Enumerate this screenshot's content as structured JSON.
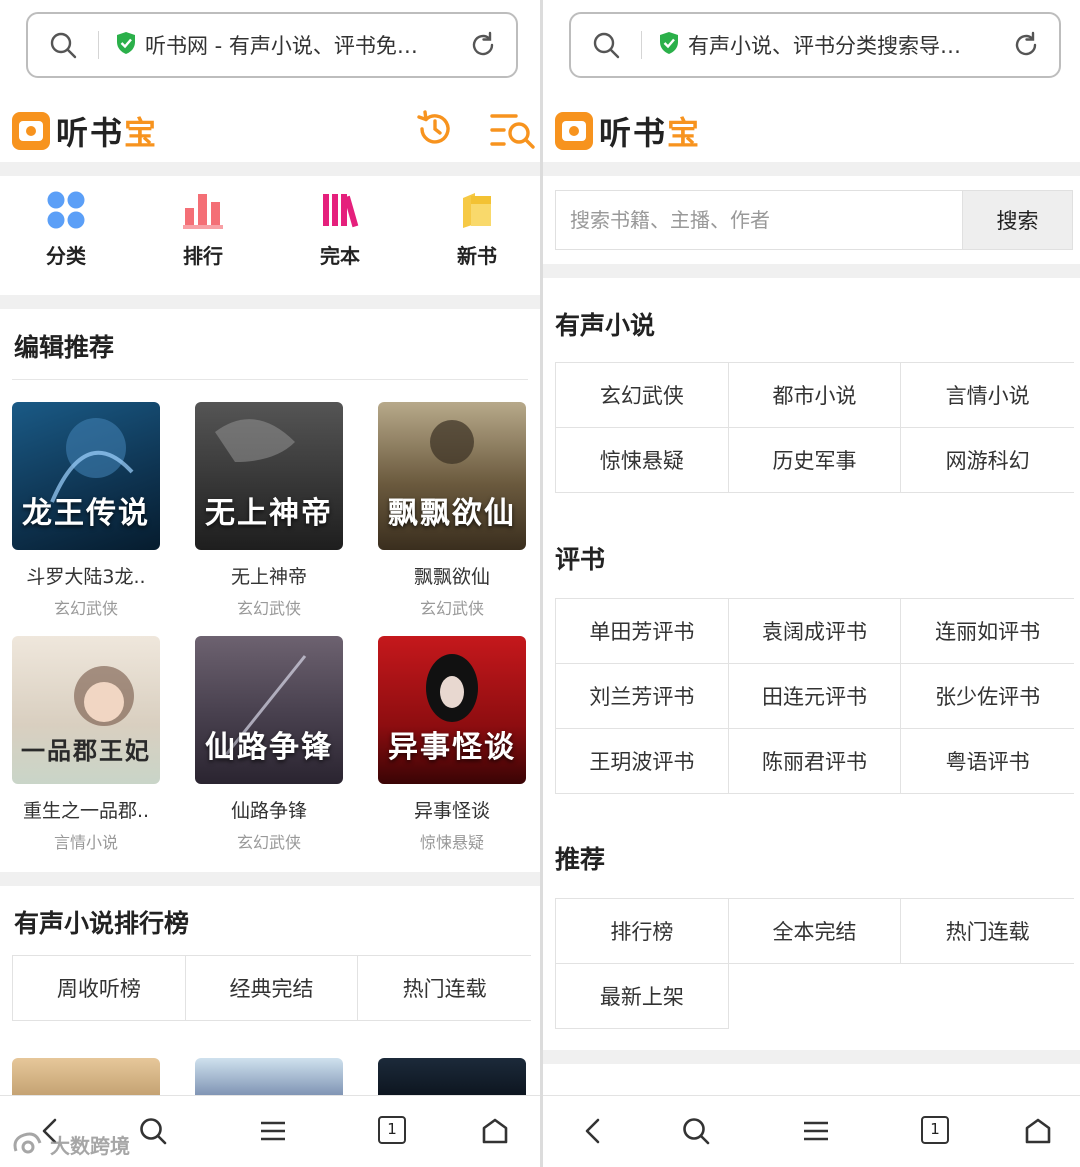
{
  "left": {
    "url_title": "听书网 - 有声小说、评书免…",
    "logo": {
      "part1": "听书",
      "part2": "宝"
    },
    "nav": [
      {
        "label": "分类",
        "icon": "grid-icon"
      },
      {
        "label": "排行",
        "icon": "bar-chart-icon"
      },
      {
        "label": "完本",
        "icon": "books-icon"
      },
      {
        "label": "新书",
        "icon": "new-book-icon"
      }
    ],
    "editor_title": "编辑推荐",
    "books": [
      {
        "title": "斗罗大陆3龙..",
        "category": "玄幻武侠",
        "cover_text": "龙王传说",
        "cover_bg": "#0e3350"
      },
      {
        "title": "无上神帝",
        "category": "玄幻武侠",
        "cover_text": "无上神帝",
        "cover_bg": "#2b2b2b"
      },
      {
        "title": "飘飘欲仙",
        "category": "玄幻武侠",
        "cover_text": "飘飘欲仙",
        "cover_bg": "#6b5a3e"
      },
      {
        "title": "重生之一品郡..",
        "category": "言情小说",
        "cover_text": "一品郡王妃",
        "cover_bg": "#d9cfc0"
      },
      {
        "title": "仙路争锋",
        "category": "玄幻武侠",
        "cover_text": "仙路争锋",
        "cover_bg": "#4a4250"
      },
      {
        "title": "异事怪谈",
        "category": "惊悚悬疑",
        "cover_text": "异事怪谈",
        "cover_bg": "#8e0d10"
      }
    ],
    "ranking_title": "有声小说排行榜",
    "ranking_tabs": [
      "周收听榜",
      "经典完结",
      "热门连载"
    ],
    "watermark": "大数跨境"
  },
  "right": {
    "url_title": "有声小说、评书分类搜索导…",
    "logo": {
      "part1": "听书",
      "part2": "宝"
    },
    "search": {
      "placeholder": "搜索书籍、主播、作者",
      "button": "搜索"
    },
    "sections": [
      {
        "title": "有声小说",
        "items": [
          "玄幻武侠",
          "都市小说",
          "言情小说",
          "惊悚悬疑",
          "历史军事",
          "网游科幻"
        ]
      },
      {
        "title": "评书",
        "items": [
          "单田芳评书",
          "袁阔成评书",
          "连丽如评书",
          "刘兰芳评书",
          "田连元评书",
          "张少佐评书",
          "王玥波评书",
          "陈丽君评书",
          "粤语评书"
        ]
      },
      {
        "title": "推荐",
        "items": [
          "排行榜",
          "全本完结",
          "热门连载",
          "最新上架"
        ]
      }
    ]
  },
  "bottom_bar": {
    "tab_count": "1"
  },
  "colors": {
    "brand": "#f7931e",
    "shield": "#2bb04a"
  }
}
